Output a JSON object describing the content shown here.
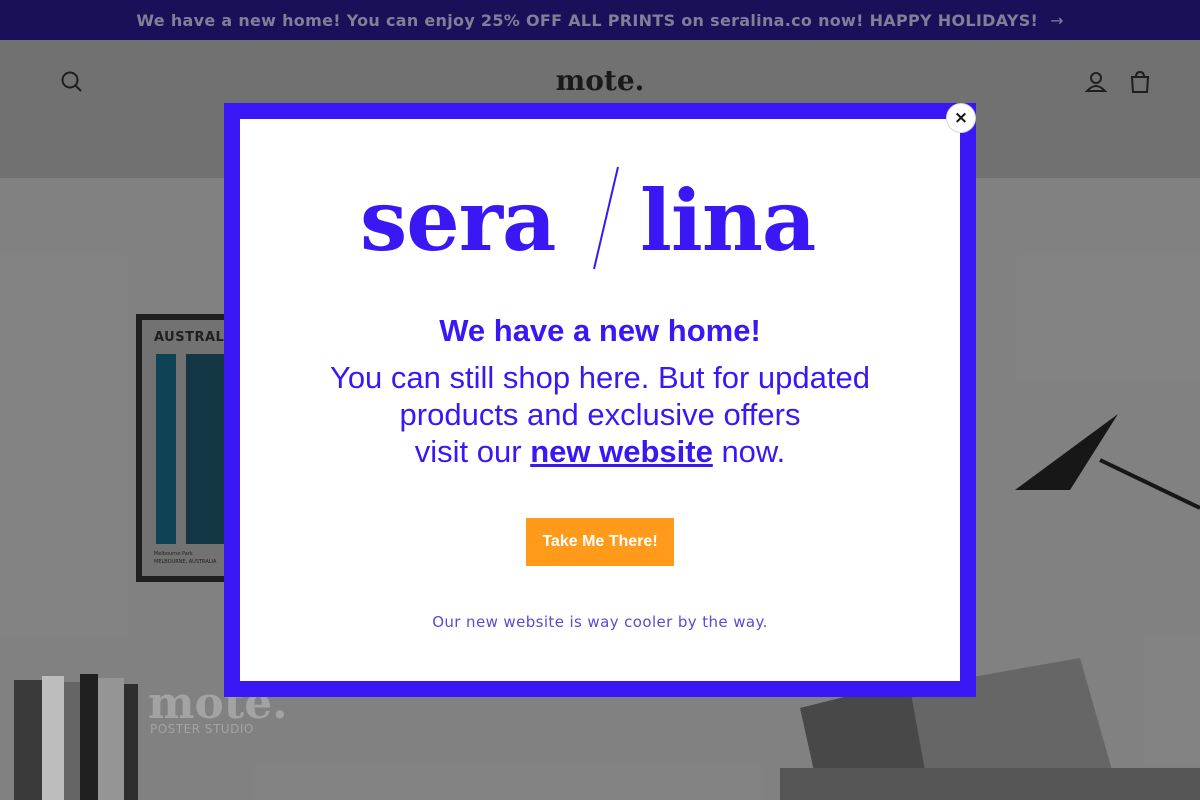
{
  "announcement": {
    "text": "We have a new home! You can enjoy 25% OFF ALL PRINTS on seralina.co now! HAPPY HOLIDAYS!",
    "arrow": "→"
  },
  "header": {
    "logo": "mote.",
    "icons": [
      "search-icon",
      "account-icon",
      "cart-icon"
    ]
  },
  "hero": {
    "poster_title": "AUSTRALI",
    "poster_caption_1": "Melbourne Park",
    "poster_caption_2": "MELBOURNE, AUSTRALIA",
    "logo": "mote.",
    "subtitle": "POSTER STUDIO"
  },
  "modal": {
    "brand_left": "sera",
    "brand_right": "lina",
    "headline": "We have a new home!",
    "para_line1": "You can still shop here. But for updated",
    "para_line2": "products and exclusive offers",
    "para_prefix": "visit our",
    "link_text": "new website",
    "para_suffix": "now.",
    "cta_label": "Take Me There!",
    "footnote": "Our new website is way cooler by the way.",
    "close_label": "×"
  },
  "colors": {
    "brand": "#3a18f5",
    "cta": "#ff9a1a",
    "announcement_bg": "#14095e"
  }
}
